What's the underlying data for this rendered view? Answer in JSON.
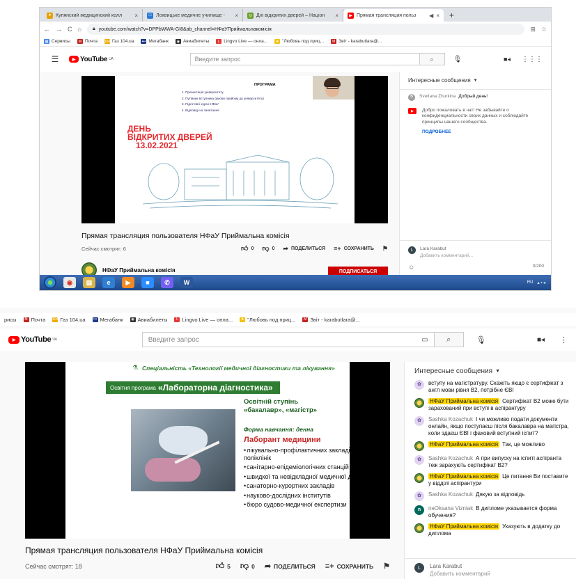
{
  "shot1": {
    "tabs": [
      {
        "icon": "location-pin-icon",
        "color": "#e8a200",
        "label": "Купянский медицинский колл"
      },
      {
        "icon": "site-icon",
        "color": "#2b7bd6",
        "label": "Лохвицьке медичне училище -"
      },
      {
        "icon": "site-icon",
        "color": "#6a9f2a",
        "label": "Дні відкритих дверей – Націон"
      },
      {
        "icon": "youtube-icon",
        "color": "#ff0000",
        "label": "Прямая трансляция польз"
      }
    ],
    "url": "youtube.com/watch?v=DPPbWWA-GI8&ab_channel=НФаУПриймальнакомісія",
    "bookmarks": [
      {
        "label": "Сервисы",
        "color": "#4285f4",
        "glyph": "▦"
      },
      {
        "label": "Почта",
        "color": "#c5221f",
        "glyph": "M"
      },
      {
        "label": "Газ 104.ua",
        "color": "#f2a900",
        "glyph": "104"
      },
      {
        "label": "Мегабанк",
        "color": "#1e3a8a",
        "glyph": "•••"
      },
      {
        "label": "Авиабилеты",
        "color": "#333333",
        "glyph": "◉"
      },
      {
        "label": "Lingvo Live — онла...",
        "color": "#e53935",
        "glyph": "L"
      },
      {
        "label": "\"Любовь под приц...",
        "color": "#f4c20d",
        "glyph": "★"
      },
      {
        "label": "Звіт - karabutlara@...",
        "color": "#c5221f",
        "glyph": "M"
      }
    ],
    "logo": "YouTube",
    "logo_region": "UA",
    "search_placeholder": "Введите запрос",
    "slide": {
      "program_title": "ПРОГРАМА",
      "program_items": [
        "1. Презентація університету",
        "2. Путівник вступника (умови прийому до університету)",
        "3. Підготовчі курси НФаУ",
        "4. Відповіді на запитання"
      ],
      "day_line1": "ДЕНЬ",
      "day_line2": "ВІДКРИТИХ ДВЕРЕЙ",
      "day_line3": "13.02.2021"
    },
    "video_title": "Прямая трансляция пользователя НФаУ Приймальна комісія",
    "viewers": "Сейчас смотрят: 6",
    "likes": "0",
    "dislikes": "0",
    "share": "ПОДЕЛИТЬСЯ",
    "save": "СОХРАНИТЬ",
    "channel_name": "НФаУ Приймальна комісія",
    "subscribe": "ПОДПИСАТЬСЯ",
    "chat": {
      "header": "Интересные сообщения",
      "messages": [
        {
          "avatar_letter": "S",
          "avatar_color": "#9e9e9e",
          "author": "Svetlana Zhurkina",
          "text": "Добрый день!"
        }
      ],
      "notice": "Добро пожаловать в чат! Не забывайте о конфиденциальности своих данных и соблюдайте принципы нашего сообщества.",
      "more": "ПОДРОБНЕЕ",
      "input_user": "Lara Karabut",
      "input_placeholder": "Добавить комментарий...",
      "counter": "0/200"
    },
    "taskbar_lang": "RU"
  },
  "shot2": {
    "bookmarks": [
      {
        "label": "рисы",
        "color": "#ffffff",
        "glyph": ""
      },
      {
        "label": "Почта",
        "color": "#c5221f",
        "glyph": "M"
      },
      {
        "label": "Газ 104.ua",
        "color": "#f2a900",
        "glyph": "104"
      },
      {
        "label": "Мегабанк",
        "color": "#1e3a8a",
        "glyph": "•••"
      },
      {
        "label": "Авиабилеты",
        "color": "#333333",
        "glyph": "◉"
      },
      {
        "label": "Lingvo Live — онла...",
        "color": "#e53935",
        "glyph": "L"
      },
      {
        "label": "\"Любовь под приц...",
        "color": "#f4c20d",
        "glyph": "★"
      },
      {
        "label": "Звіт - karabutlara@...",
        "color": "#c5221f",
        "glyph": "M"
      }
    ],
    "logo": "YouTube",
    "logo_region": "UA",
    "search_placeholder": "Введите запрос",
    "slide": {
      "specialty": "Спеціальність «Технології медичної діагностики та лікування»",
      "band_prefix": "Освітня програма",
      "band_title": "«Лабораторна діагностика»",
      "step_line1": "Освітній ступінь",
      "step_line2": "«бакалавр», «магістр»",
      "form": "Форма навчання: денна",
      "lab_title": "Лаборант медицини",
      "bullets": [
        "лікувально-профілактичних закладів, поліклінік",
        "санітарно-епідеміологічних станцій",
        "швидкої та невідкладної медичної допомоги",
        "санаторно-курортних закладів",
        "науково-дослідних інститутів",
        "бюро судово-медичної експертизи"
      ]
    },
    "video_title": "Прямая трансляция пользователя НФаУ Приймальна комісія",
    "viewers": "Сейчас смотрят: 18",
    "likes": "5",
    "dislikes": "0",
    "share": "ПОДЕЛИТЬСЯ",
    "save": "СОХРАНИТЬ",
    "chat": {
      "header": "Интересные сообщения",
      "messages": [
        {
          "type": "user",
          "author": "",
          "text": "вступу на магістратуру. Скажіть якщо є сертифікат з англ мови рівня В2, потрібне ЄВІ"
        },
        {
          "type": "owner",
          "author": "НФаУ Приймальна комісія",
          "text": "Сертифікат В2 може бути зарахований при вступі в аспірантуру"
        },
        {
          "type": "user",
          "author": "Sashka Kozachuk",
          "text": "І чи можливо подати документи онлайн, якщо поступаєш після бакалавра на магістра, коли здаєш ЄВІ і фаховий вступний іспит?"
        },
        {
          "type": "owner",
          "author": "НФаУ Приймальна комісія",
          "text": "Так, це можливо"
        },
        {
          "type": "user",
          "author": "Sashka Kozachuk",
          "text": "А при випуску на іспиті аспіранта теж зарахують сертифікат В2?"
        },
        {
          "type": "owner",
          "author": "НФаУ Приймальна комісія",
          "text": "Це питання Ви поставите у відділі аспірантури"
        },
        {
          "type": "user",
          "author": "Sashka Kozachuk",
          "text": "Дякую за відповідь"
        },
        {
          "type": "letter",
          "avatar_letter": "n",
          "author": "пнOksana Vizniak",
          "text": "В дипломе указывается форма обучения?"
        },
        {
          "type": "owner",
          "author": "НФаУ Приймальна комісія",
          "text": "Указують в додатку до диплома"
        }
      ],
      "input_user": "Lara Karabut",
      "input_placeholder": "Добавить комментарий"
    }
  },
  "colors": {
    "yt_red": "#ff0000",
    "owner_highlight": "#ffd600",
    "slide_green": "#2e7d32",
    "slide_red": "#e5282d"
  }
}
